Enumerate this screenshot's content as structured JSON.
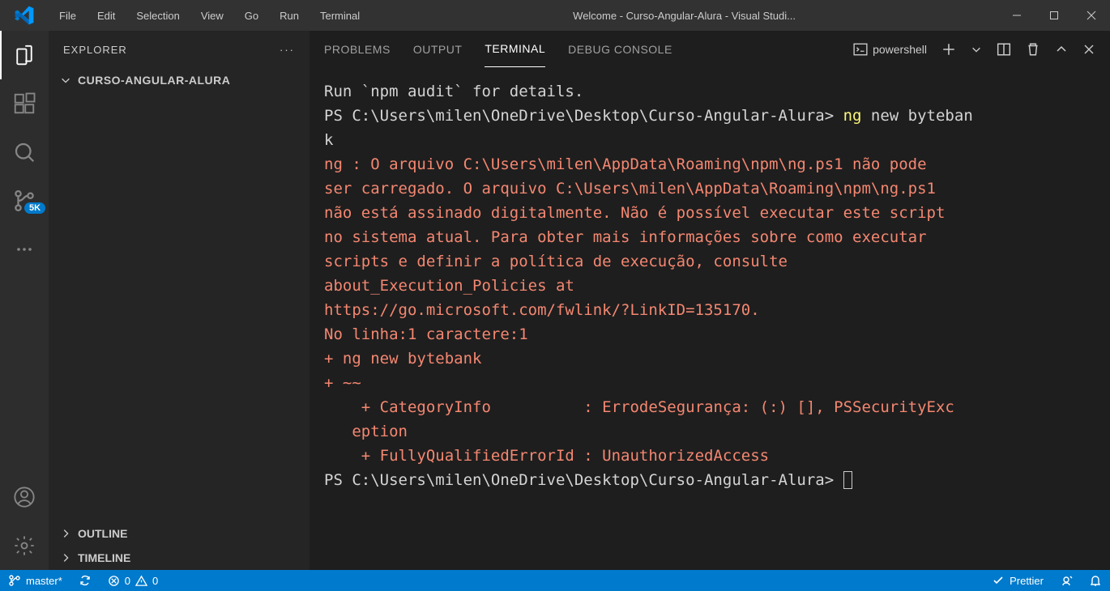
{
  "menu": {
    "file": "File",
    "edit": "Edit",
    "selection": "Selection",
    "view": "View",
    "go": "Go",
    "run": "Run",
    "terminal": "Terminal"
  },
  "title": "Welcome - Curso-Angular-Alura - Visual Studi...",
  "explorer": {
    "title": "EXPLORER",
    "folder": "CURSO-ANGULAR-ALURA",
    "outline": "OUTLINE",
    "timeline": "TIMELINE"
  },
  "scm_badge": "5K",
  "panels": {
    "problems": "PROBLEMS",
    "output": "OUTPUT",
    "terminal": "TERMINAL",
    "debug": "DEBUG CONSOLE"
  },
  "terminal_kind": "powershell",
  "term": {
    "l1": "Run `npm audit` for details.",
    "l2a": "PS C:\\Users\\milen\\OneDrive\\Desktop\\Curso-Angular-Alura> ",
    "l2cmd": "ng",
    "l2b": " new byteban",
    "l3": "k",
    "e1": "ng : O arquivo C:\\Users\\milen\\AppData\\Roaming\\npm\\ng.ps1 não pode ",
    "e2": "ser carregado. O arquivo C:\\Users\\milen\\AppData\\Roaming\\npm\\ng.ps1 ",
    "e3": "não está assinado digitalmente. Não é possível executar este script ",
    "e4": "no sistema atual. Para obter mais informações sobre como executar ",
    "e5": "scripts e definir a política de execução, consulte ",
    "e6": "about_Execution_Policies at ",
    "e7": "https://go.microsoft.com/fwlink/?LinkID=135170.",
    "e8": "No linha:1 caractere:1",
    "e9": "+ ng new bytebank",
    "e10": "+ ~~",
    "e11": "    + CategoryInfo          : ErrodeSegurança: (:) [], PSSecurityExc",
    "e12": "   eption",
    "e13": "    + FullyQualifiedErrorId : UnauthorizedAccess",
    "l4": "PS C:\\Users\\milen\\OneDrive\\Desktop\\Curso-Angular-Alura> "
  },
  "status": {
    "branch": "master*",
    "errors": "0",
    "warnings": "0",
    "prettier": "Prettier"
  }
}
